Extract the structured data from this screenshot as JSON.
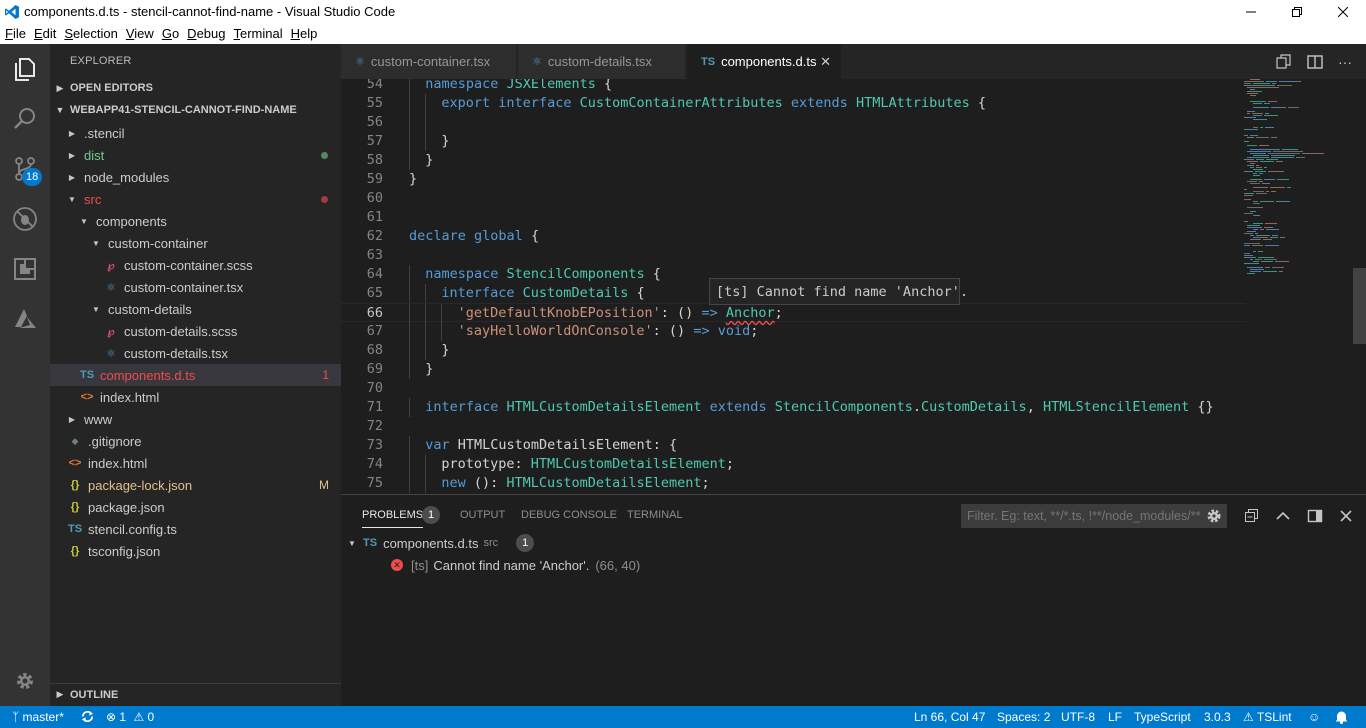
{
  "window": {
    "title": "components.d.ts - stencil-cannot-find-name - Visual Studio Code"
  },
  "menu": [
    "File",
    "Edit",
    "Selection",
    "View",
    "Go",
    "Debug",
    "Terminal",
    "Help"
  ],
  "activity": {
    "scm_badge": "18"
  },
  "sidebar": {
    "title": "EXPLORER",
    "open_editors": "OPEN EDITORS",
    "project": "WEBAPP41-STENCIL-CANNOT-FIND-NAME",
    "outline": "OUTLINE",
    "tree": [
      {
        "label": ".stencil",
        "type": "folder",
        "open": false
      },
      {
        "label": "dist",
        "type": "folder",
        "open": false
      },
      {
        "label": "node_modules",
        "type": "folder",
        "open": false
      },
      {
        "label": "src",
        "type": "folder",
        "open": true
      },
      {
        "label": "components",
        "type": "folder",
        "open": true
      },
      {
        "label": "custom-container",
        "type": "folder",
        "open": true
      },
      {
        "label": "custom-container.scss",
        "type": "scss"
      },
      {
        "label": "custom-container.tsx",
        "type": "tsx"
      },
      {
        "label": "custom-details",
        "type": "folder",
        "open": true
      },
      {
        "label": "custom-details.scss",
        "type": "scss"
      },
      {
        "label": "custom-details.tsx",
        "type": "tsx"
      },
      {
        "label": "components.d.ts",
        "type": "ts",
        "icon": "TS",
        "deco": "1"
      },
      {
        "label": "index.html",
        "type": "html",
        "icon": "<>"
      },
      {
        "label": "www",
        "type": "folder",
        "open": false
      },
      {
        "label": ".gitignore",
        "type": "git"
      },
      {
        "label": "index.html",
        "type": "html",
        "icon": "<>"
      },
      {
        "label": "package-lock.json",
        "type": "json",
        "icon": "{}",
        "deco": "M"
      },
      {
        "label": "package.json",
        "type": "json",
        "icon": "{}"
      },
      {
        "label": "stencil.config.ts",
        "type": "ts",
        "icon": "TS"
      },
      {
        "label": "tsconfig.json",
        "type": "json",
        "icon": "{}"
      }
    ]
  },
  "tabs": [
    {
      "label": "custom-container.tsx",
      "active": false
    },
    {
      "label": "custom-details.tsx",
      "active": false
    },
    {
      "label": "components.d.ts",
      "icon": "TS",
      "active": true
    }
  ],
  "editor": {
    "lines": [
      {
        "n": "54",
        "indent": 1,
        "tokens": [
          [
            "kw",
            "namespace "
          ],
          [
            "ty",
            "JSXElements"
          ],
          [
            "pu",
            " {"
          ]
        ]
      },
      {
        "n": "55",
        "indent": 2,
        "tokens": [
          [
            "kw",
            "export "
          ],
          [
            "kw",
            "interface "
          ],
          [
            "ty",
            "CustomContainerAttributes "
          ],
          [
            "kw",
            "extends "
          ],
          [
            "ty",
            "HTMLAttributes"
          ],
          [
            "pu",
            " {"
          ]
        ]
      },
      {
        "n": "56",
        "indent": 2,
        "tokens": []
      },
      {
        "n": "57",
        "indent": 2,
        "tokens": [
          [
            "pu",
            "}"
          ]
        ]
      },
      {
        "n": "58",
        "indent": 1,
        "tokens": [
          [
            "pu",
            "}"
          ]
        ]
      },
      {
        "n": "59",
        "indent": 0,
        "tokens": [
          [
            "pu",
            "}"
          ]
        ]
      },
      {
        "n": "60",
        "indent": 0,
        "tokens": []
      },
      {
        "n": "61",
        "indent": 0,
        "tokens": []
      },
      {
        "n": "62",
        "indent": 0,
        "tokens": [
          [
            "kw",
            "declare "
          ],
          [
            "kw",
            "global"
          ],
          [
            "pu",
            " {"
          ]
        ]
      },
      {
        "n": "63",
        "indent": 0,
        "tokens": []
      },
      {
        "n": "64",
        "indent": 1,
        "tokens": [
          [
            "kw",
            "namespace "
          ],
          [
            "ty",
            "StencilComponents"
          ],
          [
            "pu",
            " {"
          ]
        ]
      },
      {
        "n": "65",
        "indent": 2,
        "tokens": [
          [
            "kw",
            "interface "
          ],
          [
            "ty",
            "CustomDetails"
          ],
          [
            "pu",
            " {"
          ]
        ]
      },
      {
        "n": "66",
        "indent": 3,
        "tokens": [
          [
            "str",
            "'getDefaultKnobEPosition'"
          ],
          [
            "pu",
            ": () "
          ],
          [
            "kw",
            "=> "
          ],
          [
            "tyerr",
            "Anchor"
          ],
          [
            "pu",
            ";"
          ]
        ],
        "current": true
      },
      {
        "n": "67",
        "indent": 3,
        "tokens": [
          [
            "str",
            "'sayHelloWorldOnConsole'"
          ],
          [
            "pu",
            ": () "
          ],
          [
            "kw",
            "=> "
          ],
          [
            "kw",
            "void"
          ],
          [
            "pu",
            ";"
          ]
        ]
      },
      {
        "n": "68",
        "indent": 2,
        "tokens": [
          [
            "pu",
            "}"
          ]
        ]
      },
      {
        "n": "69",
        "indent": 1,
        "tokens": [
          [
            "pu",
            "}"
          ]
        ]
      },
      {
        "n": "70",
        "indent": 0,
        "tokens": []
      },
      {
        "n": "71",
        "indent": 1,
        "tokens": [
          [
            "kw",
            "interface "
          ],
          [
            "ty",
            "HTMLCustomDetailsElement "
          ],
          [
            "kw",
            "extends "
          ],
          [
            "ty",
            "StencilComponents"
          ],
          [
            "pu",
            "."
          ],
          [
            "ty",
            "CustomDetails"
          ],
          [
            "pu",
            ", "
          ],
          [
            "ty",
            "HTMLStencilElement"
          ],
          [
            "pu",
            " {}"
          ]
        ]
      },
      {
        "n": "72",
        "indent": 0,
        "tokens": []
      },
      {
        "n": "73",
        "indent": 1,
        "tokens": [
          [
            "kw",
            "var "
          ],
          [
            "pu",
            "HTMLCustomDetailsElement: {"
          ]
        ]
      },
      {
        "n": "74",
        "indent": 2,
        "tokens": [
          [
            "pu",
            "prototype: "
          ],
          [
            "ty",
            "HTMLCustomDetailsElement"
          ],
          [
            "pu",
            ";"
          ]
        ]
      },
      {
        "n": "75",
        "indent": 2,
        "tokens": [
          [
            "kw",
            "new "
          ],
          [
            "pu",
            "(): "
          ],
          [
            "ty",
            "HTMLCustomDetailsElement"
          ],
          [
            "pu",
            ";"
          ]
        ]
      }
    ],
    "hover": "[ts] Cannot find name 'Anchor'."
  },
  "panel": {
    "tabs": [
      {
        "label": "PROBLEMS",
        "active": true,
        "count": "1"
      },
      {
        "label": "OUTPUT",
        "active": false
      },
      {
        "label": "DEBUG CONSOLE",
        "active": false
      },
      {
        "label": "TERMINAL",
        "active": false
      }
    ],
    "filter_placeholder": "Filter. Eg: text, **/*.ts, !**/node_modules/**",
    "file": {
      "name": "components.d.ts",
      "dir": "src",
      "count": "1"
    },
    "problem": {
      "source": "[ts]",
      "message": "Cannot find name 'Anchor'.",
      "location": "(66, 40)"
    }
  },
  "status": {
    "branch": "master*",
    "errors": "1",
    "warnings": "0",
    "position": "Ln 66, Col 47",
    "spaces": "Spaces: 2",
    "encoding": "UTF-8",
    "eol": "LF",
    "language": "TypeScript",
    "version": "3.0.3",
    "linter": "TSLint"
  },
  "colors": {
    "accent": "#007acc",
    "error": "#f14c4c",
    "modified": "#e2c08d"
  }
}
